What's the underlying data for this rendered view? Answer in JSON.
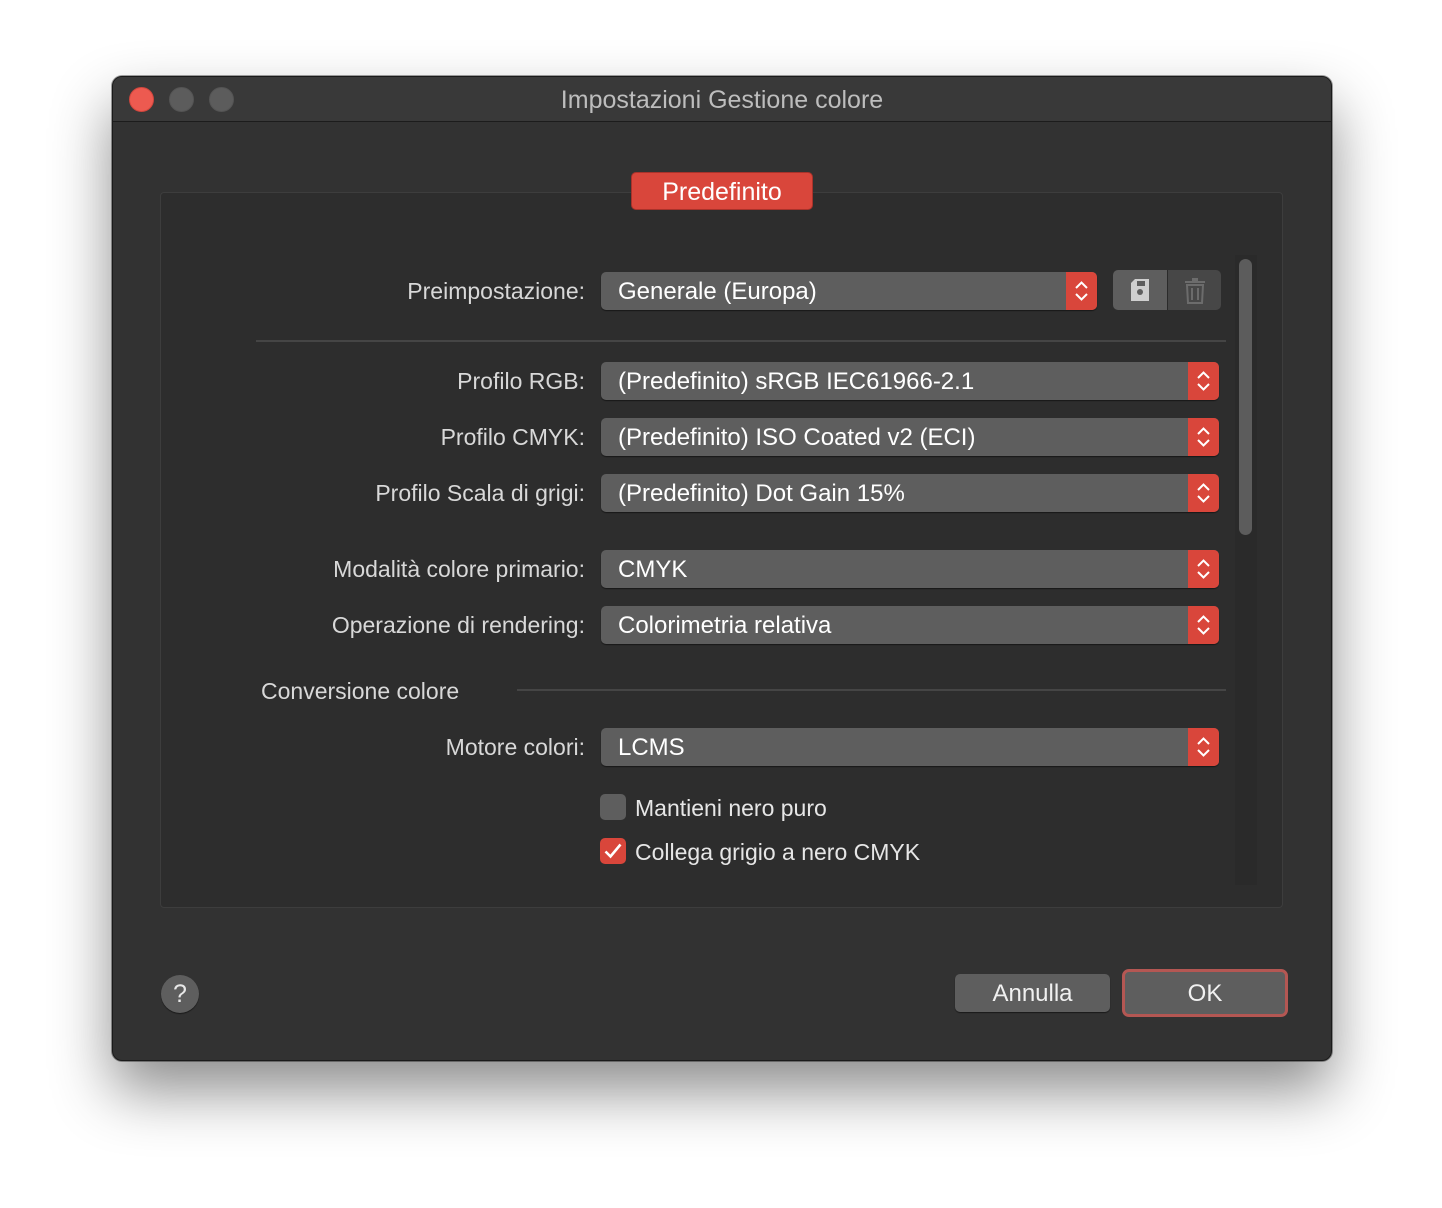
{
  "window": {
    "title": "Impostazioni Gestione colore"
  },
  "tab": {
    "label": "Predefinito"
  },
  "preset": {
    "label": "Preimpostazione:",
    "value": "Generale (Europa)"
  },
  "toolbar_icons": {
    "save": "save-preset-icon",
    "delete": "trash-icon"
  },
  "profiles": {
    "rgb": {
      "label": "Profilo RGB:",
      "value": "(Predefinito) sRGB IEC61966-2.1"
    },
    "cmyk": {
      "label": "Profilo CMYK:",
      "value": "(Predefinito) ISO Coated v2 (ECI)"
    },
    "gray": {
      "label": "Profilo Scala di grigi:",
      "value": "(Predefinito) Dot Gain 15%"
    }
  },
  "primary_mode": {
    "label": "Modalità colore primario:",
    "value": "CMYK"
  },
  "rendering": {
    "label": "Operazione di rendering:",
    "value": "Colorimetria relativa"
  },
  "conversion": {
    "section_title": "Conversione colore",
    "engine": {
      "label": "Motore colori:",
      "value": "LCMS"
    },
    "keep_black": {
      "label": "Mantieni nero puro",
      "checked": false
    },
    "link_gray": {
      "label": "Collega grigio a nero CMYK",
      "checked": true
    }
  },
  "footer": {
    "help": "?",
    "cancel": "Annulla",
    "ok": "OK"
  },
  "colors": {
    "accent": "#d9463b",
    "window_bg": "#323232",
    "control_bg": "#5e5e5e"
  }
}
